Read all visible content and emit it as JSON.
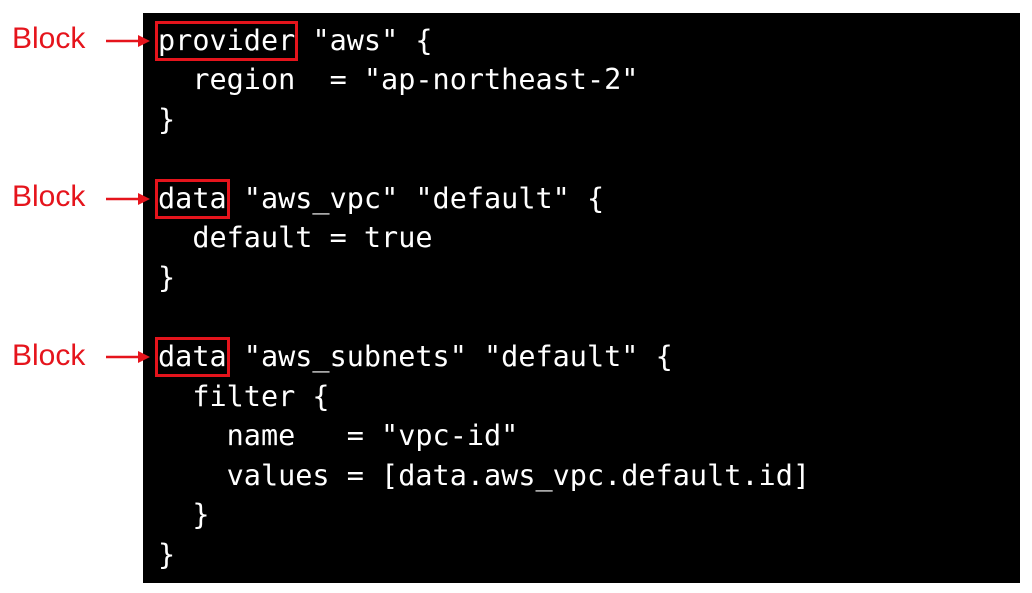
{
  "colors": {
    "background": "#ffffff",
    "code_background": "#000000",
    "code_text": "#ffffff",
    "annotation": "#e5141c"
  },
  "annotations": [
    {
      "label": "Block",
      "target_line": 0
    },
    {
      "label": "Block",
      "target_line": 4
    },
    {
      "label": "Block",
      "target_line": 8
    }
  ],
  "code": {
    "lines": [
      {
        "keyword": "provider",
        "rest": " \"aws\" {"
      },
      {
        "keyword": "",
        "rest": "  region  = \"ap-northeast-2\""
      },
      {
        "keyword": "",
        "rest": "}"
      },
      {
        "keyword": "",
        "rest": ""
      },
      {
        "keyword": "data",
        "rest": " \"aws_vpc\" \"default\" {"
      },
      {
        "keyword": "",
        "rest": "  default = true"
      },
      {
        "keyword": "",
        "rest": "}"
      },
      {
        "keyword": "",
        "rest": ""
      },
      {
        "keyword": "data",
        "rest": " \"aws_subnets\" \"default\" {"
      },
      {
        "keyword": "",
        "rest": "  filter {"
      },
      {
        "keyword": "",
        "rest": "    name   = \"vpc-id\""
      },
      {
        "keyword": "",
        "rest": "    values = [data.aws_vpc.default.id]"
      },
      {
        "keyword": "",
        "rest": "  }"
      },
      {
        "keyword": "",
        "rest": "}"
      }
    ]
  }
}
